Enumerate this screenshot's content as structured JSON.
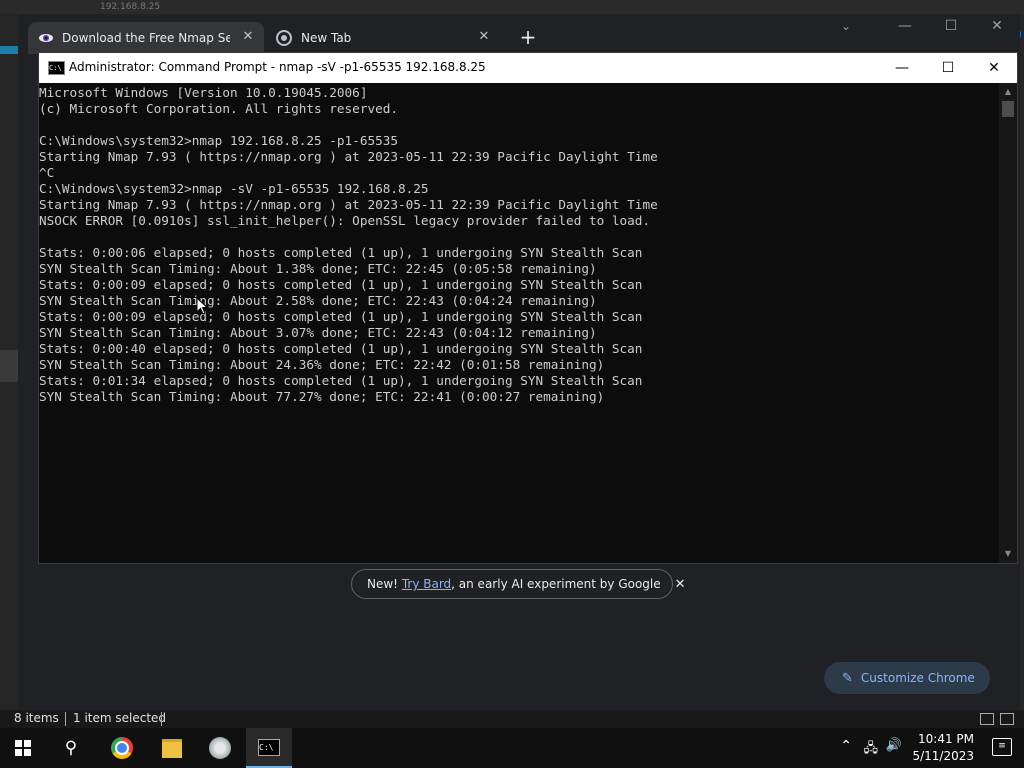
{
  "explorer": {
    "address_fragment": "192.168.8.25",
    "status_items": "8 items",
    "status_selected": "1 item selected"
  },
  "chrome": {
    "tabs": [
      {
        "label": "Download the Free Nmap Securi",
        "icon": "nmap-eye-icon",
        "active": true
      },
      {
        "label": "New Tab",
        "icon": "chrome-icon",
        "active": false
      }
    ],
    "bard_prefix": "New! ",
    "bard_link": "Try Bard",
    "bard_suffix": ", an early AI experiment by Google",
    "customize_label": "Customize Chrome"
  },
  "cmd": {
    "title": "Administrator: Command Prompt - nmap  -sV -p1-65535 192.168.8.25",
    "lines": [
      "Microsoft Windows [Version 10.0.19045.2006]",
      "(c) Microsoft Corporation. All rights reserved.",
      "",
      "C:\\Windows\\system32>nmap 192.168.8.25 -p1-65535",
      "Starting Nmap 7.93 ( https://nmap.org ) at 2023-05-11 22:39 Pacific Daylight Time",
      "^C",
      "C:\\Windows\\system32>nmap -sV -p1-65535 192.168.8.25",
      "Starting Nmap 7.93 ( https://nmap.org ) at 2023-05-11 22:39 Pacific Daylight Time",
      "NSOCK ERROR [0.0910s] ssl_init_helper(): OpenSSL legacy provider failed to load.",
      "",
      "Stats: 0:00:06 elapsed; 0 hosts completed (1 up), 1 undergoing SYN Stealth Scan",
      "SYN Stealth Scan Timing: About 1.38% done; ETC: 22:45 (0:05:58 remaining)",
      "Stats: 0:00:09 elapsed; 0 hosts completed (1 up), 1 undergoing SYN Stealth Scan",
      "SYN Stealth Scan Timing: About 2.58% done; ETC: 22:43 (0:04:24 remaining)",
      "Stats: 0:00:09 elapsed; 0 hosts completed (1 up), 1 undergoing SYN Stealth Scan",
      "SYN Stealth Scan Timing: About 3.07% done; ETC: 22:43 (0:04:12 remaining)",
      "Stats: 0:00:40 elapsed; 0 hosts completed (1 up), 1 undergoing SYN Stealth Scan",
      "SYN Stealth Scan Timing: About 24.36% done; ETC: 22:42 (0:01:58 remaining)",
      "Stats: 0:01:34 elapsed; 0 hosts completed (1 up), 1 undergoing SYN Stealth Scan",
      "SYN Stealth Scan Timing: About 77.27% done; ETC: 22:41 (0:00:27 remaining)"
    ]
  },
  "taskbar": {
    "apps": [
      "windows-start-icon",
      "search-icon",
      "chrome-icon",
      "file-explorer-icon",
      "nmap-zenmap-icon",
      "command-prompt-icon"
    ],
    "time": "10:41 PM",
    "date": "5/11/2023"
  },
  "colors": {
    "console_bg": "#0c0c0c",
    "console_text": "#cccccc",
    "chrome_bg": "#202124",
    "link": "#8ab4f8",
    "taskbar_active": "#6cb4e8"
  }
}
